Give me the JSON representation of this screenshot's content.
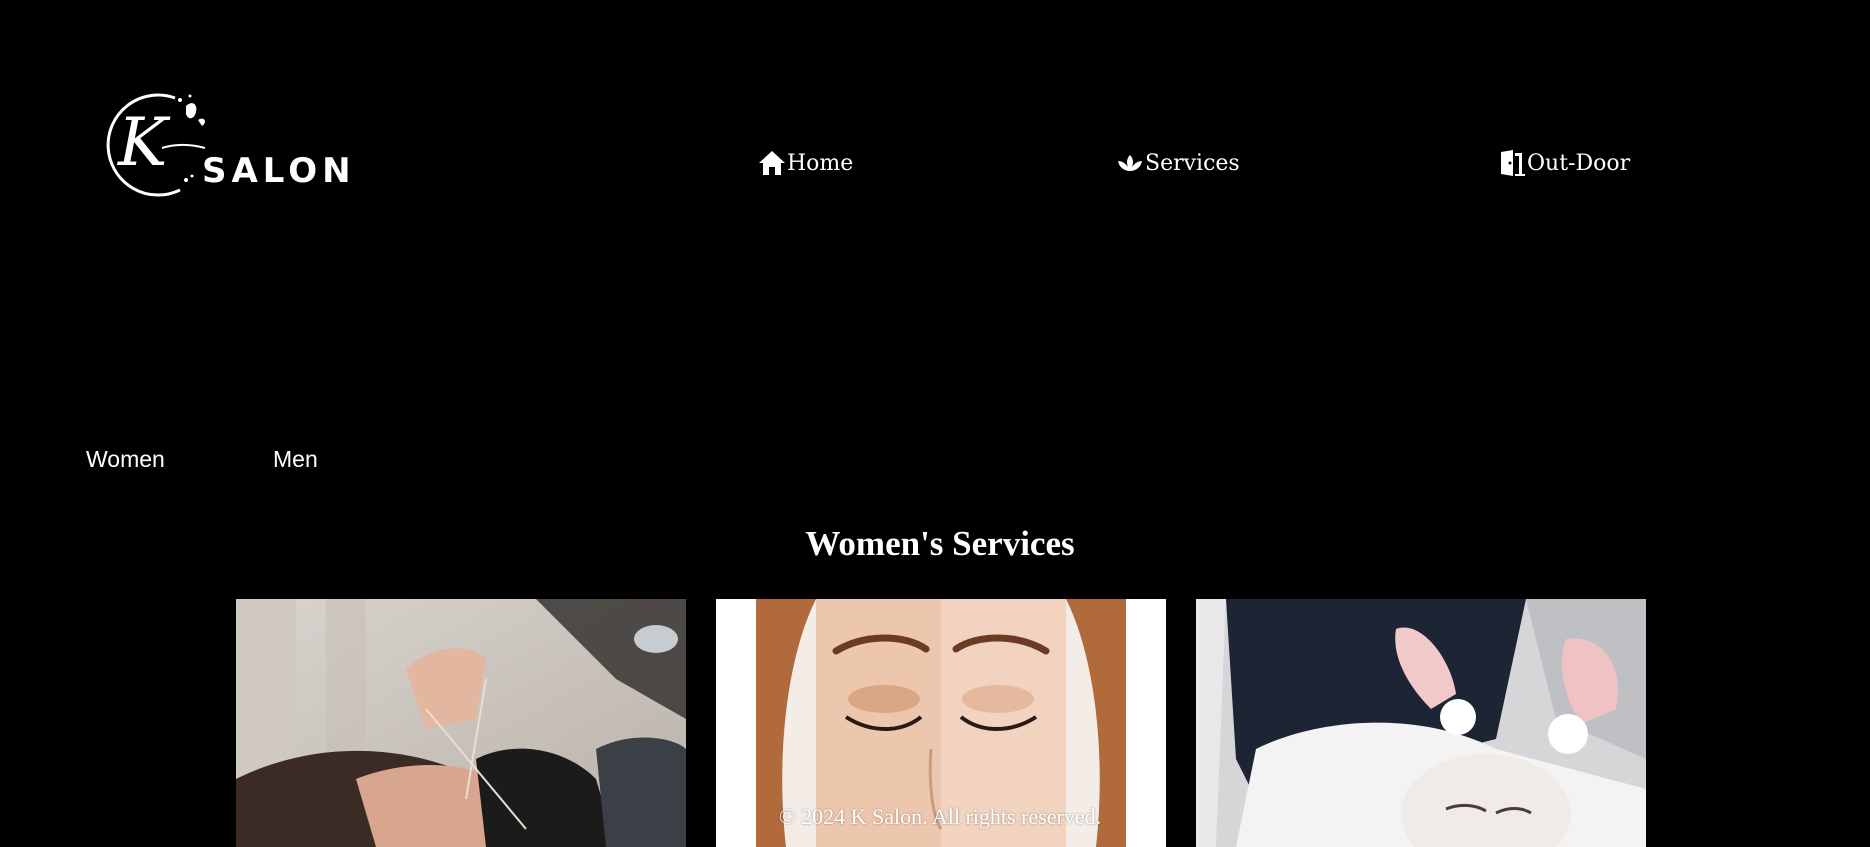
{
  "header": {
    "logo": {
      "initial": "K",
      "wordmark": "SALON"
    },
    "nav": [
      {
        "label": "Home",
        "icon": "home-icon"
      },
      {
        "label": "Services",
        "icon": "lotus-icon"
      },
      {
        "label": "Out-Door",
        "icon": "door-icon"
      }
    ]
  },
  "tabs": [
    {
      "label": "Women"
    },
    {
      "label": "Men"
    }
  ],
  "section": {
    "title": "Women's Services"
  },
  "cards": [
    {
      "image": "threading-photo"
    },
    {
      "image": "eyebrow-makeup-photo"
    },
    {
      "image": "facial-photo"
    }
  ],
  "footer": {
    "text": "© 2024 K Salon. All rights reserved."
  },
  "colors": {
    "background": "#000000",
    "text": "#ffffff"
  }
}
